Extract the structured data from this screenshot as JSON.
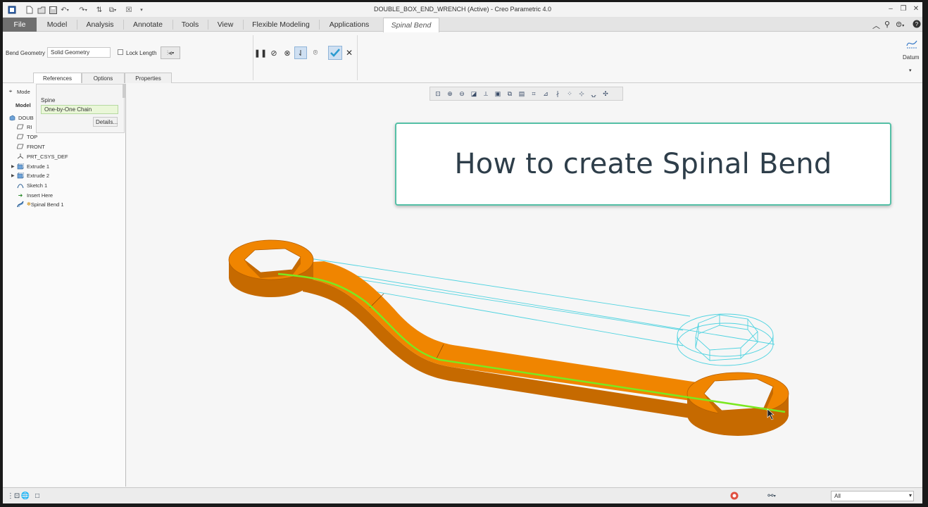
{
  "window": {
    "title": "DOUBLE_BOX_END_WRENCH (Active) - Creo Parametric 4.0",
    "qat_icons": [
      "app-icon",
      "new-icon",
      "open-icon",
      "save-icon",
      "undo-icon",
      "redo-icon",
      "regenerate-icon",
      "windows-icon",
      "close-window-icon",
      "customize-icon"
    ]
  },
  "menu": {
    "tabs": [
      "File",
      "Model",
      "Analysis",
      "Annotate",
      "Tools",
      "View",
      "Flexible Modeling",
      "Applications"
    ],
    "active_tab": "Spinal Bend"
  },
  "ribbon": {
    "bend_geometry_label": "Bend Geometry",
    "bend_geometry_value": "Solid Geometry",
    "lock_length_label": "Lock Length",
    "panel_tabs": [
      "References",
      "Options",
      "Properties"
    ],
    "datum_label": "Datum"
  },
  "references_panel": {
    "spine_label": "Spine",
    "chain_value": "One-by-One Chain",
    "details_button": "Details..."
  },
  "model_tree": {
    "header": "Mode",
    "column_header": "Model",
    "items": [
      {
        "label": "DOUB",
        "icon": "part-icon"
      },
      {
        "label": "RI",
        "icon": "datum-plane-icon"
      },
      {
        "label": "TOP",
        "icon": "datum-plane-icon"
      },
      {
        "label": "FRONT",
        "icon": "datum-plane-icon"
      },
      {
        "label": "PRT_CSYS_DEF",
        "icon": "csys-icon"
      },
      {
        "label": "Extrude 1",
        "icon": "extrude-icon"
      },
      {
        "label": "Extrude 2",
        "icon": "extrude-icon"
      },
      {
        "label": "Sketch 1",
        "icon": "sketch-icon"
      },
      {
        "label": "Insert Here",
        "icon": "insert-arrow-icon"
      },
      {
        "label": "Spinal Bend 1",
        "icon": "spinal-bend-icon"
      }
    ]
  },
  "overlay": {
    "title": "How to create Spinal Bend"
  },
  "statusbar": {
    "filter_value": "All"
  },
  "colors": {
    "part_orange": "#f08500",
    "part_edge": "#b55f00",
    "spine_green": "#7be820",
    "preview_cyan": "#4fd3e0",
    "overlay_border": "#55c0a6"
  }
}
